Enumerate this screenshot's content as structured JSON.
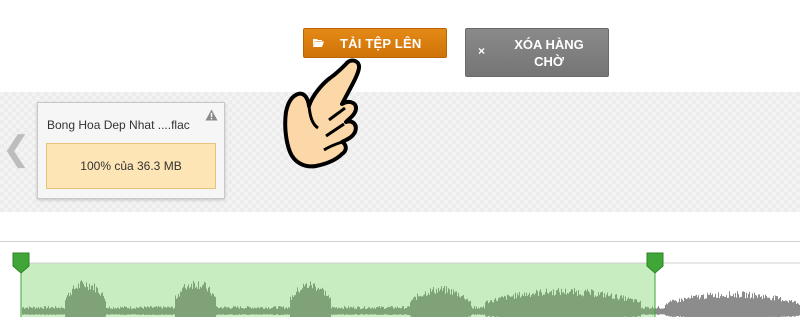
{
  "toolbar": {
    "upload_label": "TẢI TỆP LÊN",
    "clear_label_line1": "XÓA HÀNG",
    "clear_label_line2": "CHỜ",
    "clear_icon": "×"
  },
  "queue": {
    "nav_arrow": "❮",
    "file": {
      "name": "Bong Hoa Dep Nhat ....flac",
      "progress_text": "100% của 36.3 MB",
      "progress": 1.0
    }
  },
  "colors": {
    "upload_button": "#d97c0c",
    "clear_button": "#7f7f7f",
    "progress_fill": "#fde5b5",
    "selection": "#c8edc0",
    "wave_selected": "#7fa279",
    "wave_unselected": "#8c8c8c",
    "marker": "#3fa637"
  },
  "icons": {
    "upload": "folder-open-icon",
    "clear": "close-icon",
    "warning": "warning-icon",
    "pointer": "pointing-hand-icon"
  }
}
